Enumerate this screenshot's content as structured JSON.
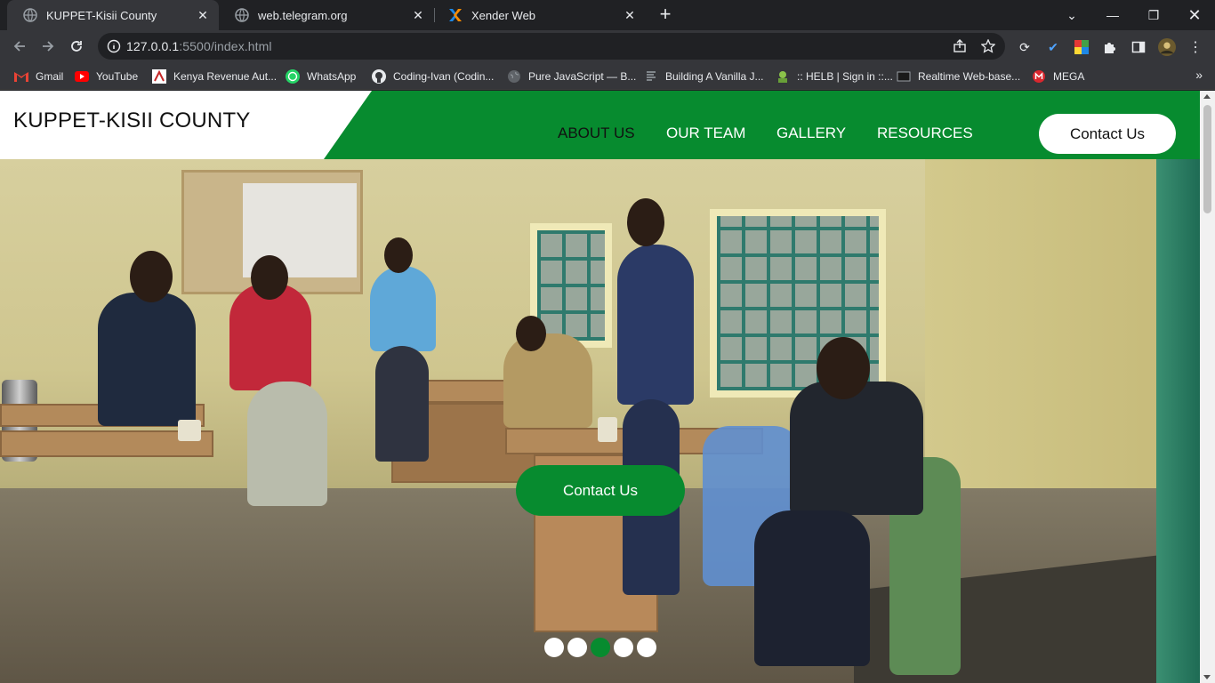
{
  "browser": {
    "tabs": [
      {
        "title": "KUPPET-Kisii County",
        "icon": "globe-icon",
        "active": true
      },
      {
        "title": "web.telegram.org",
        "icon": "globe-icon",
        "active": false
      },
      {
        "title": "Xender Web",
        "icon": "xender-icon",
        "active": false
      }
    ],
    "url_host": "127.0.0.1",
    "url_rest": ":5500/index.html",
    "bookmarks": [
      {
        "label": "Gmail",
        "icon": "gmail-icon"
      },
      {
        "label": "YouTube",
        "icon": "youtube-icon"
      },
      {
        "label": "Kenya Revenue Aut...",
        "icon": "kra-icon"
      },
      {
        "label": "WhatsApp",
        "icon": "whatsapp-icon"
      },
      {
        "label": "Coding-Ivan (Codin...",
        "icon": "github-icon"
      },
      {
        "label": "Pure JavaScript — B...",
        "icon": "globe-icon"
      },
      {
        "label": "Building A Vanilla J...",
        "icon": "site-icon"
      },
      {
        "label": ":: HELB | Sign in ::...",
        "icon": "helb-icon"
      },
      {
        "label": "Realtime Web-base...",
        "icon": "page-icon"
      },
      {
        "label": "MEGA",
        "icon": "mega-icon"
      }
    ]
  },
  "site": {
    "brand": "KUPPET-KISII COUNTY",
    "nav": [
      "ABOUT US",
      "OUR TEAM",
      "GALLERY",
      "RESOURCES"
    ],
    "contact_button": "Contact Us",
    "hero_button": "Contact Us",
    "slider": {
      "count": 5,
      "active_index": 2
    },
    "colors": {
      "brand_green": "#078b2f",
      "white": "#ffffff"
    }
  }
}
